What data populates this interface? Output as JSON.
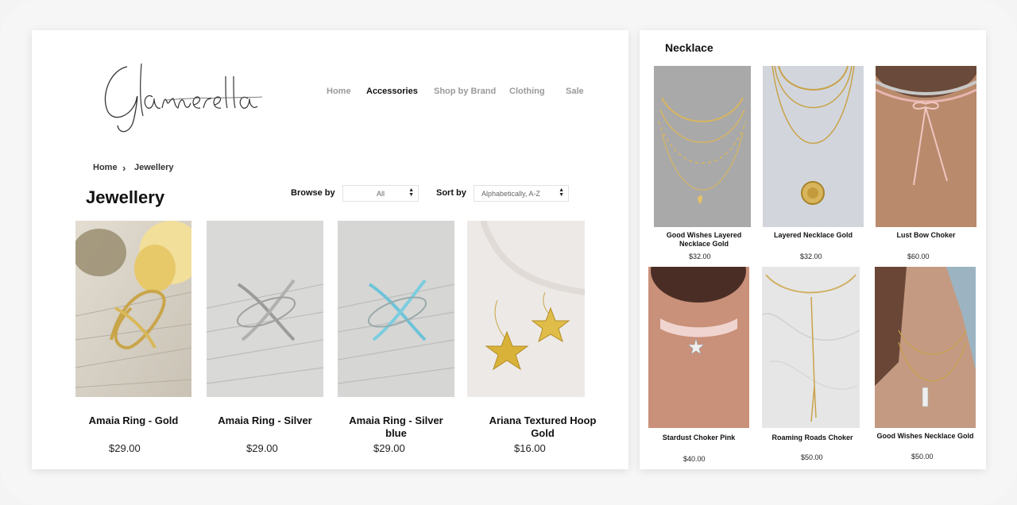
{
  "brand": {
    "logo_text": "Glamerella"
  },
  "nav": {
    "items": [
      {
        "label": "Home"
      },
      {
        "label": "Accessories"
      },
      {
        "label": "Shop by Brand"
      },
      {
        "label": "Clothing"
      },
      {
        "label": "Sale"
      }
    ],
    "active": "Accessories"
  },
  "breadcrumb": {
    "home": "Home",
    "separator": "›",
    "current": "Jewellery"
  },
  "page": {
    "title": "Jewellery"
  },
  "filters": {
    "browse_label": "Browse by",
    "browse_value": "All",
    "sort_label": "Sort by",
    "sort_value": "Alphabetically, A-Z"
  },
  "products": [
    {
      "name": "Amaia Ring - Gold",
      "price": "$29.00",
      "image": "gold-x-ring"
    },
    {
      "name": "Amaia Ring - Silver",
      "price": "$29.00",
      "image": "silver-x-ring"
    },
    {
      "name": "Amaia Ring - Silver blue",
      "price": "$29.00",
      "image": "blue-x-ring"
    },
    {
      "name": "Ariana Textured Hoop Gold",
      "price": "$16.00",
      "image": "star-earrings"
    }
  ],
  "necklace_panel": {
    "title": "Necklace",
    "items": [
      {
        "name": "Good Wishes Layered Necklace Gold",
        "price": "$32.00",
        "image": "layered-gold-necklace"
      },
      {
        "name": "Layered Necklace Gold",
        "price": "$32.00",
        "image": "coin-pendant-necklace"
      },
      {
        "name": "Lust Bow Choker",
        "price": "$60.00",
        "image": "bow-choker"
      },
      {
        "name": "Stardust Choker Pink",
        "price": "$40.00",
        "image": "star-choker"
      },
      {
        "name": "Roaming Roads Choker",
        "price": "$50.00",
        "image": "lariat-choker"
      },
      {
        "name": "Good Wishes Necklace Gold",
        "price": "$50.00",
        "image": "bar-pendant-necklace"
      }
    ]
  },
  "colors": {
    "nav_inactive": "#9a9a9a",
    "text": "#111111",
    "gold": "#c9a54a",
    "silver": "#a9a9a9",
    "turquoise": "#6cc3d9"
  }
}
